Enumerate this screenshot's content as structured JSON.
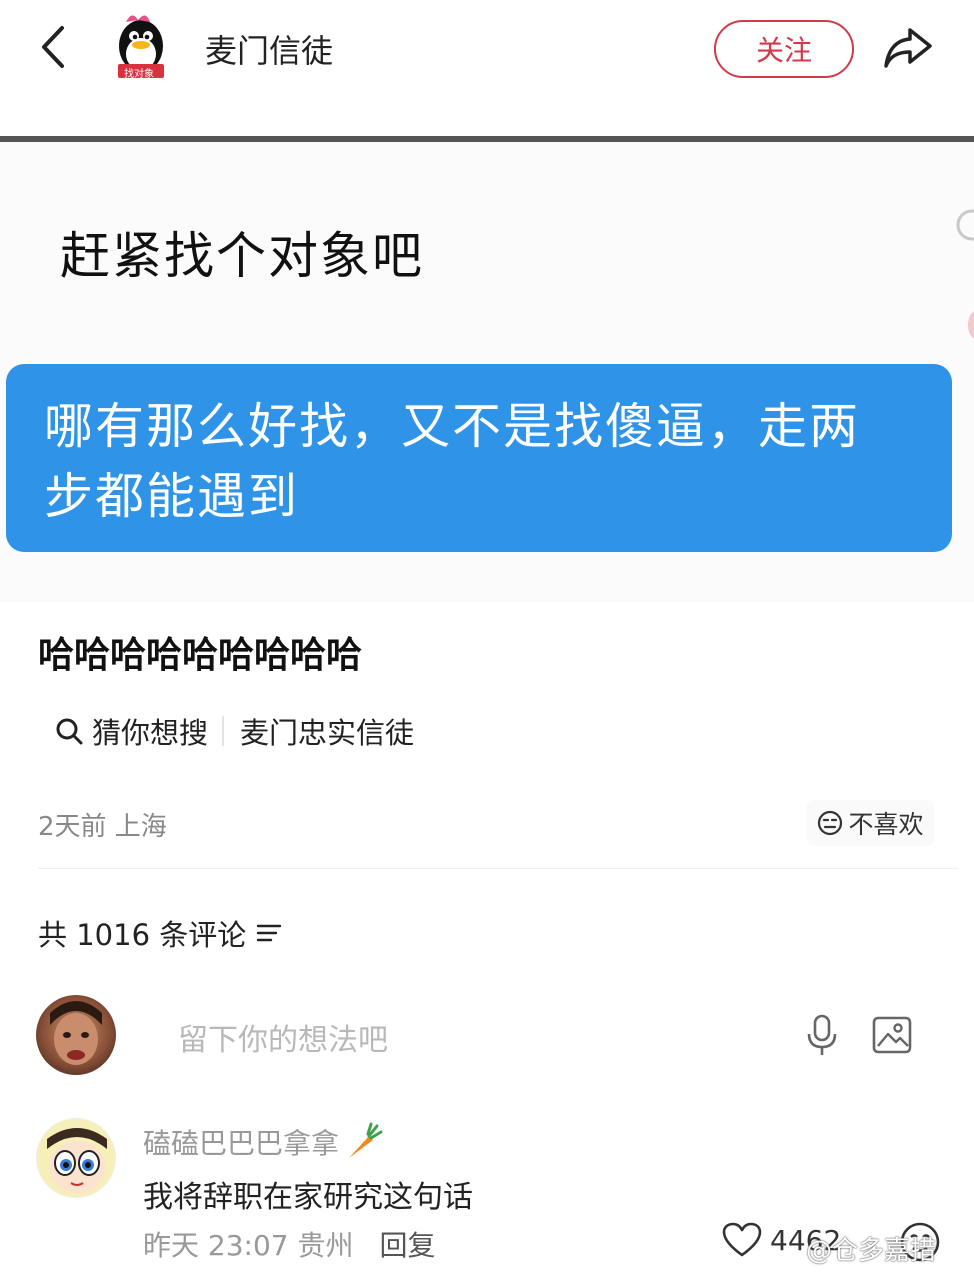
{
  "header": {
    "author_name": "麦门信徒",
    "avatar_badge": "找对象",
    "follow_label": "关注"
  },
  "post": {
    "prompt_text": "赶紧找个对象吧",
    "reply_line1": "哪有那么好找，又不是找傻逼，走两",
    "reply_line2": "步都能遇到",
    "caption": "哈哈哈哈哈哈哈哈哈",
    "search_label": "猜你想搜",
    "search_suggestion": "麦门忠实信徒",
    "meta": "2天前 上海",
    "dislike_label": "不喜欢"
  },
  "comments": {
    "count_label": "共 1016 条评论",
    "input_placeholder": "留下你的想法吧",
    "items": [
      {
        "name": "磕磕巴巴巴拿拿",
        "text": "我将辞职在家研究这句话",
        "time": "昨天 23:07",
        "location": "贵州",
        "reply_label": "回复",
        "likes": "4462"
      }
    ]
  },
  "watermark": "@仓多嘉措",
  "colors": {
    "accent_red": "#d23a4a",
    "bubble_blue": "#2f93e8"
  },
  "icons": [
    "back-icon",
    "share-icon",
    "search-icon",
    "dislike-face-icon",
    "sort-icon",
    "mic-icon",
    "image-icon",
    "carrot-icon",
    "heart-icon",
    "face-icon"
  ]
}
